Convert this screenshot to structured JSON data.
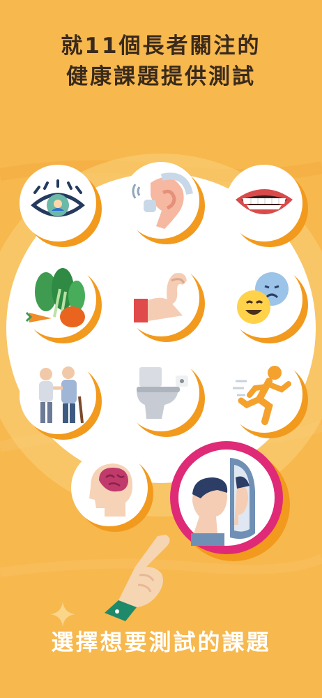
{
  "header": {
    "title_line1": "就11個長者關注的",
    "title_line2": "健康課題提供測試"
  },
  "footer": {
    "instruction": "選擇想要測試的課題"
  },
  "topics": [
    {
      "icon": "eye-icon"
    },
    {
      "icon": "ear-hearing-aid-icon"
    },
    {
      "icon": "mouth-teeth-icon"
    },
    {
      "icon": "vegetables-icon"
    },
    {
      "icon": "flexed-arm-icon"
    },
    {
      "icon": "emotion-faces-icon"
    },
    {
      "icon": "elderly-walking-icon"
    },
    {
      "icon": "toilet-icon"
    },
    {
      "icon": "running-person-icon"
    },
    {
      "icon": "brain-head-icon"
    },
    {
      "icon": "mirror-reflection-icon",
      "selected": true
    }
  ],
  "colors": {
    "background": "#f7b84e",
    "ring_shadow": "#f29a1e",
    "selected_ring": "#df2a77",
    "title_text": "#3a2a1c",
    "instruction_text": "#ffffff"
  }
}
